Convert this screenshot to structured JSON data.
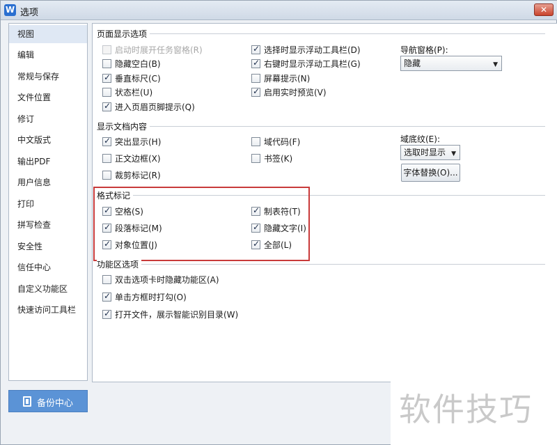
{
  "window": {
    "title": "选项",
    "app_icon_letter": "W",
    "close_label": "✕"
  },
  "sidebar": {
    "items": [
      {
        "label": "视图"
      },
      {
        "label": "编辑"
      },
      {
        "label": "常规与保存"
      },
      {
        "label": "文件位置"
      },
      {
        "label": "修订"
      },
      {
        "label": "中文版式"
      },
      {
        "label": "输出PDF"
      },
      {
        "label": "用户信息"
      },
      {
        "label": "打印"
      },
      {
        "label": "拼写检查"
      },
      {
        "label": "安全性"
      },
      {
        "label": "信任中心"
      },
      {
        "label": "自定义功能区"
      },
      {
        "label": "快速访问工具栏"
      }
    ],
    "active": "视图"
  },
  "backup": {
    "label": "备份中心"
  },
  "page_display": {
    "title": "页面显示选项",
    "options": [
      {
        "label": "启动时展开任务窗格(R)",
        "checked": false,
        "disabled": true
      },
      {
        "label": "隐藏空白(B)",
        "checked": false
      },
      {
        "label": "垂直标尺(C)",
        "checked": true
      },
      {
        "label": "状态栏(U)",
        "checked": false
      },
      {
        "label": "进入页眉页脚提示(Q)",
        "checked": true
      },
      {
        "label": "选择时显示浮动工具栏(D)",
        "checked": true
      },
      {
        "label": "右键时显示浮动工具栏(G)",
        "checked": true
      },
      {
        "label": "屏幕提示(N)",
        "checked": false
      },
      {
        "label": "启用实时预览(V)",
        "checked": true
      }
    ],
    "nav_pane_label": "导航窗格(P):",
    "nav_pane_value": "隐藏"
  },
  "doc_content": {
    "title": "显示文档内容",
    "options": [
      {
        "label": "突出显示(H)",
        "checked": true
      },
      {
        "label": "正文边框(X)",
        "checked": false
      },
      {
        "label": "裁剪标记(R)",
        "checked": false
      },
      {
        "label": "域代码(F)",
        "checked": false
      },
      {
        "label": "书签(K)",
        "checked": false
      }
    ],
    "field_shading_label": "域底纹(E):",
    "field_shading_value": "选取时显示",
    "font_sub_button": "字体替换(O)..."
  },
  "format_marks": {
    "title": "格式标记",
    "options": [
      {
        "label": "空格(S)",
        "checked": true
      },
      {
        "label": "段落标记(M)",
        "checked": true
      },
      {
        "label": "对象位置(J)",
        "checked": true
      },
      {
        "label": "制表符(T)",
        "checked": true
      },
      {
        "label": "隐藏文字(I)",
        "checked": true
      },
      {
        "label": "全部(L)",
        "checked": true
      }
    ]
  },
  "ribbon": {
    "title": "功能区选项",
    "options": [
      {
        "label": "双击选项卡时隐藏功能区(A)",
        "checked": false
      },
      {
        "label": "单击方框时打勾(O)",
        "checked": true
      },
      {
        "label": "打开文件，展示智能识别目录(W)",
        "checked": true
      }
    ]
  },
  "watermark": {
    "text": "软件技巧"
  },
  "colors": {
    "accent": "#5b93d6",
    "highlight_border": "#c83a3a",
    "close_red": "#c9432c"
  }
}
